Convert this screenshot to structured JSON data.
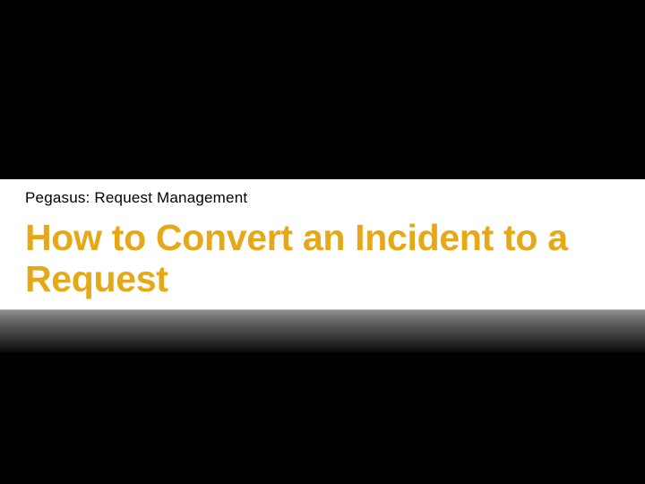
{
  "slide": {
    "subtitle": "Pegasus: Request Management",
    "title": "How to Convert an Incident to a Request"
  }
}
